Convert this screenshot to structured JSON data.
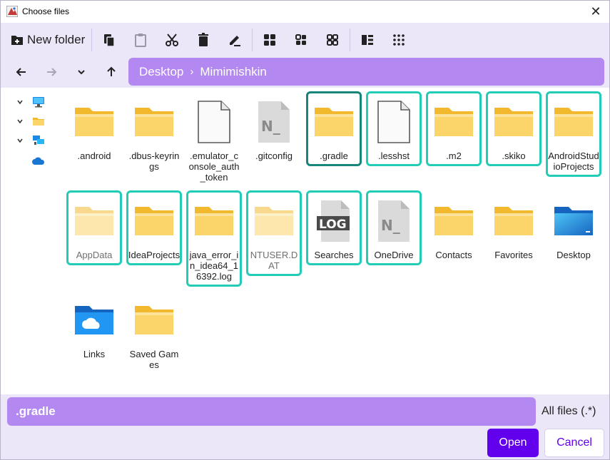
{
  "window": {
    "title": "Choose files",
    "close_icon": "close-icon"
  },
  "toolbar": {
    "new_folder_label": "New folder",
    "buttons": [
      "copy-icon",
      "paste-icon",
      "cut-icon",
      "delete-icon",
      "rename-icon",
      "large-icons-view-icon",
      "medium-icons-view-icon",
      "small-icons-view-icon",
      "details-view-icon",
      "list-view-icon"
    ]
  },
  "nav": {
    "breadcrumb": [
      "Desktop",
      "Mimimishkin"
    ],
    "separator": "›"
  },
  "tree": {
    "items": [
      {
        "icon": "this-pc-icon"
      },
      {
        "icon": "folder-icon"
      },
      {
        "icon": "network-icon"
      },
      {
        "icon": "onedrive-cloud-icon"
      }
    ]
  },
  "files": [
    {
      "name": ".android",
      "icon": "folder-icon",
      "state": "none"
    },
    {
      "name": ".dbus-keyrings",
      "icon": "folder-icon",
      "state": "none"
    },
    {
      "name": ".emulator_console_auth_token",
      "icon": "file-icon",
      "state": "none"
    },
    {
      "name": ".gitconfig",
      "icon": "notepad-file-icon",
      "state": "none"
    },
    {
      "name": ".gradle",
      "icon": "folder-icon",
      "state": "focused"
    },
    {
      "name": ".lesshst",
      "icon": "file-icon",
      "state": "selected"
    },
    {
      "name": ".m2",
      "icon": "folder-icon",
      "state": "selected"
    },
    {
      "name": ".skiko",
      "icon": "folder-icon",
      "state": "selected"
    },
    {
      "name": "AndroidStudioProjects",
      "icon": "folder-icon",
      "state": "selected"
    },
    {
      "name": "AppData",
      "icon": "folder-icon",
      "state": "selected",
      "hidden": true
    },
    {
      "name": "IdeaProjects",
      "icon": "folder-icon",
      "state": "selected"
    },
    {
      "name": "java_error_in_idea64_16392.log",
      "icon": "folder-icon",
      "state": "selected"
    },
    {
      "name": "NTUSER.DAT",
      "icon": "folder-icon",
      "state": "selected",
      "hidden": true
    },
    {
      "name": "Searches",
      "icon": "log-file-icon",
      "state": "selected"
    },
    {
      "name": "OneDrive",
      "icon": "notepad-file-icon",
      "state": "selected"
    },
    {
      "name": "Contacts",
      "icon": "folder-icon",
      "state": "none"
    },
    {
      "name": "Favorites",
      "icon": "folder-icon",
      "state": "none"
    },
    {
      "name": "Desktop",
      "icon": "desktop-folder-icon",
      "state": "none"
    },
    {
      "name": "Links",
      "icon": "onedrive-folder-icon",
      "state": "none"
    },
    {
      "name": "Saved Games",
      "icon": "folder-icon",
      "state": "none"
    }
  ],
  "bottom": {
    "filename_value": ".gradle",
    "filter_label": "All files (.*)",
    "open_label": "Open",
    "cancel_label": "Cancel"
  },
  "colors": {
    "accent": "#6200ee",
    "breadcrumb_bg": "#b388f0",
    "panel_bg": "#ece7f8",
    "selection_border": "#22ccb7",
    "focus_border": "#16857a",
    "folder_yellow": "#f8c94a"
  }
}
